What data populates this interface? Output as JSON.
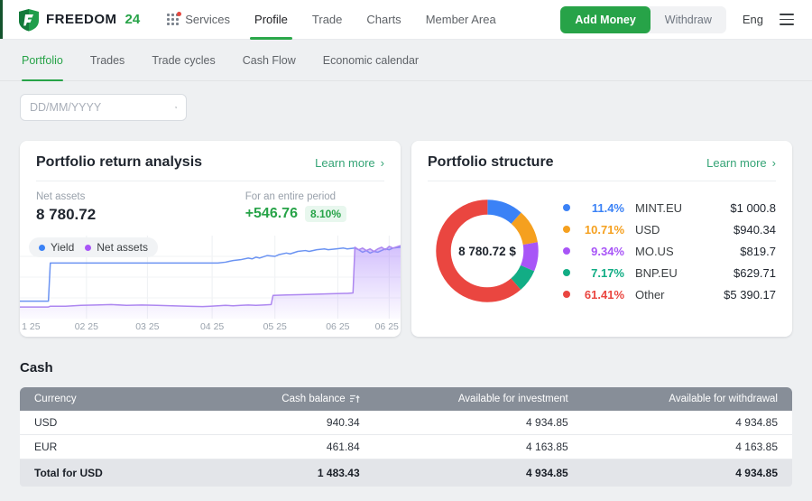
{
  "header": {
    "brand": {
      "name": "FREEDOM",
      "suffix": "24"
    },
    "nav": [
      {
        "label": "Services",
        "icon": "apps-grid",
        "active": false
      },
      {
        "label": "Profile",
        "active": true
      },
      {
        "label": "Trade",
        "active": false
      },
      {
        "label": "Charts",
        "active": false
      },
      {
        "label": "Member Area",
        "active": false
      }
    ],
    "add_money_label": "Add Money",
    "withdraw_label": "Withdraw",
    "language": "Eng"
  },
  "tabs": [
    {
      "label": "Portfolio",
      "active": true
    },
    {
      "label": "Trades",
      "active": false
    },
    {
      "label": "Trade cycles",
      "active": false
    },
    {
      "label": "Cash Flow",
      "active": false
    },
    {
      "label": "Economic calendar",
      "active": false
    }
  ],
  "date_filter": {
    "placeholder": "DD/MM/YYYY"
  },
  "return_card": {
    "title": "Portfolio return analysis",
    "learn_more": "Learn more",
    "net_assets_label": "Net assets",
    "net_assets_value": "8 780.72",
    "period_label": "For an entire period",
    "period_change": "+546.76",
    "period_pct": "8.10%"
  },
  "structure_card": {
    "title": "Portfolio structure",
    "learn_more": "Learn more"
  },
  "cash_section": {
    "title": "Cash",
    "columns": [
      "Currency",
      "Cash balance",
      "Available for investment",
      "Available for withdrawal"
    ],
    "rows": [
      {
        "currency": "USD",
        "balance": "940.34",
        "investment": "4 934.85",
        "withdrawal": "4 934.85"
      },
      {
        "currency": "EUR",
        "balance": "461.84",
        "investment": "4 163.85",
        "withdrawal": "4 163.85"
      }
    ],
    "total": {
      "label": "Total for USD",
      "balance": "1 483.43",
      "investment": "4 934.85",
      "withdrawal": "4 934.85"
    }
  },
  "chart_data": [
    {
      "type": "line",
      "title": "Portfolio return analysis",
      "legend_position": "top-left",
      "grid": {
        "vertical_x": [
          17.5,
          33.5,
          50.5,
          67,
          83.5,
          97
        ],
        "horizontal_y": [
          25,
          50,
          75
        ]
      },
      "x_ticks": [
        {
          "label": "1 25",
          "x": 0.5,
          "align": "left"
        },
        {
          "label": "02 25",
          "x": 17.5,
          "align": "center"
        },
        {
          "label": "03 25",
          "x": 33.5,
          "align": "center"
        },
        {
          "label": "04 25",
          "x": 50.5,
          "align": "center"
        },
        {
          "label": "05 25",
          "x": 67,
          "align": "center"
        },
        {
          "label": "06 25",
          "x": 83.5,
          "align": "center"
        },
        {
          "label": "06 25",
          "x": 99.5,
          "align": "right"
        }
      ],
      "series": [
        {
          "name": "Yield",
          "color": "#6b93f2",
          "dot_color": "#3b82f6",
          "fill": false,
          "points": [
            [
              0,
              79
            ],
            [
              7.5,
              79
            ],
            [
              8,
              33
            ],
            [
              48,
              33
            ],
            [
              52,
              33
            ],
            [
              54,
              32
            ],
            [
              56,
              30
            ],
            [
              58,
              29
            ],
            [
              60,
              27
            ],
            [
              61,
              28
            ],
            [
              62,
              26
            ],
            [
              63,
              27
            ],
            [
              65,
              24
            ],
            [
              67,
              25
            ],
            [
              68,
              23
            ],
            [
              70,
              21
            ],
            [
              71,
              22
            ],
            [
              73,
              19
            ],
            [
              75,
              18
            ],
            [
              76,
              19
            ],
            [
              78,
              17
            ],
            [
              80,
              16
            ],
            [
              81,
              17
            ],
            [
              83,
              16
            ],
            [
              85,
              15
            ],
            [
              86,
              16
            ],
            [
              88,
              15
            ],
            [
              89,
              17
            ],
            [
              90,
              20
            ],
            [
              91,
              18
            ],
            [
              92,
              21
            ],
            [
              93,
              19
            ],
            [
              94,
              20
            ],
            [
              95,
              18
            ],
            [
              96,
              16
            ],
            [
              97,
              17
            ],
            [
              98,
              15
            ],
            [
              100,
              14
            ]
          ]
        },
        {
          "name": "Net assets",
          "color": "#ad87f0",
          "dot_color": "#a855f7",
          "fill": true,
          "points": [
            [
              0,
              86
            ],
            [
              7.5,
              86
            ],
            [
              8,
              85
            ],
            [
              12,
              85
            ],
            [
              16,
              84
            ],
            [
              20,
              83.5
            ],
            [
              24,
              83
            ],
            [
              28,
              84
            ],
            [
              32,
              83.5
            ],
            [
              36,
              84
            ],
            [
              40,
              84.5
            ],
            [
              44,
              85
            ],
            [
              48,
              85.5
            ],
            [
              50,
              85
            ],
            [
              52,
              84.5
            ],
            [
              54,
              84
            ],
            [
              56,
              84.5
            ],
            [
              58,
              84
            ],
            [
              60,
              83.5
            ],
            [
              62,
              84
            ],
            [
              64,
              83.5
            ],
            [
              66,
              83
            ],
            [
              66.5,
              72
            ],
            [
              70,
              71.5
            ],
            [
              74,
              71
            ],
            [
              78,
              70.5
            ],
            [
              82,
              70
            ],
            [
              86,
              69.5
            ],
            [
              87.5,
              69
            ],
            [
              88,
              14
            ],
            [
              89,
              17
            ],
            [
              90,
              15
            ],
            [
              91,
              18
            ],
            [
              92,
              16
            ],
            [
              93,
              19
            ],
            [
              94,
              16
            ],
            [
              95,
              14
            ],
            [
              96,
              17
            ],
            [
              97,
              13
            ],
            [
              98,
              15
            ],
            [
              100,
              12
            ]
          ]
        }
      ]
    },
    {
      "type": "donut",
      "title": "Portfolio structure",
      "center_label": "8 780.72 $",
      "slices": [
        {
          "pct": 11.4,
          "pct_text": "11.4%",
          "label": "MINT.EU",
          "value": "$1 000.8",
          "color": "#3b82f6"
        },
        {
          "pct": 10.71,
          "pct_text": "10.71%",
          "label": "USD",
          "value": "$940.34",
          "color": "#f5a01f"
        },
        {
          "pct": 9.34,
          "pct_text": "9.34%",
          "label": "MO.US",
          "value": "$819.7",
          "color": "#a855f7"
        },
        {
          "pct": 7.17,
          "pct_text": "7.17%",
          "label": "BNP.EU",
          "value": "$629.71",
          "color": "#12ad85"
        },
        {
          "pct": 61.41,
          "pct_text": "61.41%",
          "label": "Other",
          "value": "$5 390.17",
          "color": "#ea4640"
        }
      ]
    }
  ],
  "colors": {
    "brand_green": "#27a348",
    "accent_teal": "#35a476",
    "table_header": "#878e98"
  }
}
